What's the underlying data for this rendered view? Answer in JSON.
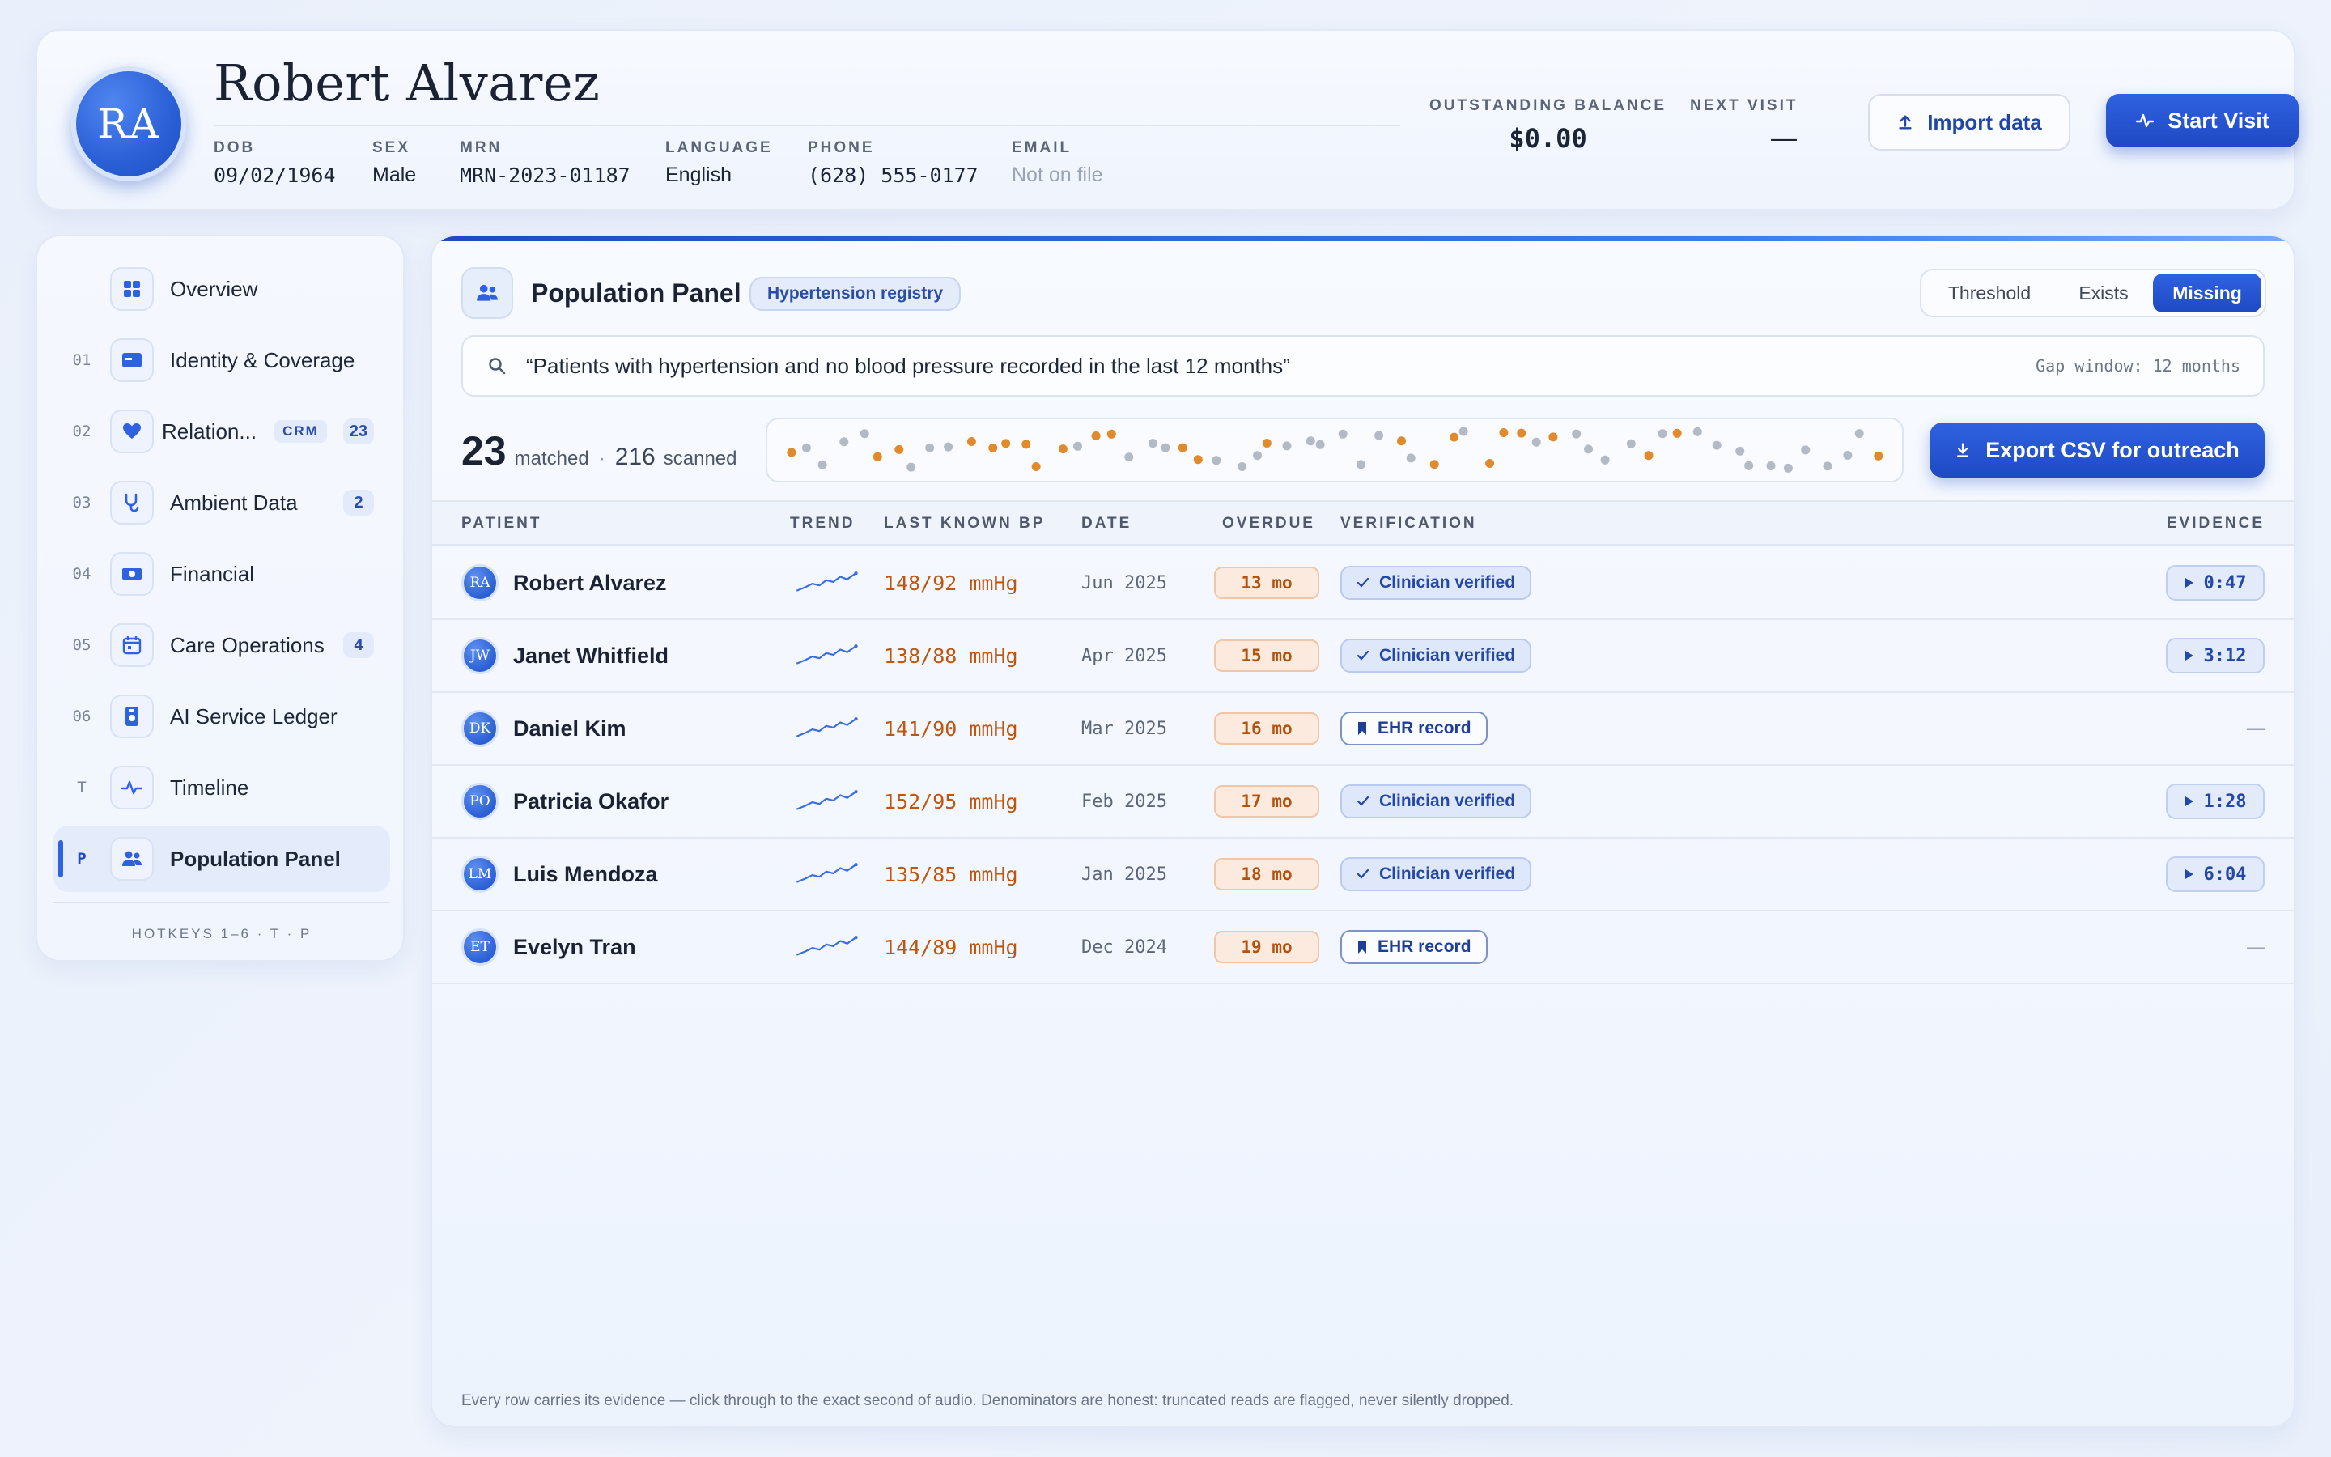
{
  "header": {
    "initials": "RA",
    "name": "Robert Alvarez",
    "fields": [
      {
        "label": "DOB",
        "value": "09/02/1964"
      },
      {
        "label": "SEX",
        "value": "Male"
      },
      {
        "label": "MRN",
        "value": "MRN-2023-01187"
      },
      {
        "label": "LANGUAGE",
        "value": "English"
      },
      {
        "label": "PHONE",
        "value": "(628) 555-0177"
      },
      {
        "label": "EMAIL",
        "value": "Not on file"
      }
    ],
    "balance_label": "OUTSTANDING BALANCE",
    "balance_value": "$0.00",
    "next_visit_label": "NEXT VISIT",
    "next_visit_value": "—",
    "import_label": "Import data",
    "start_label": "Start Visit"
  },
  "sidebar": {
    "items": [
      {
        "num": "",
        "label": "Overview",
        "icon": "grid-icon"
      },
      {
        "num": "01",
        "label": "Identity & Coverage",
        "icon": "id-card-icon"
      },
      {
        "num": "02",
        "label": "Relation...",
        "icon": "heart-icon",
        "badge": "CRM",
        "count": "23"
      },
      {
        "num": "03",
        "label": "Ambient Data",
        "icon": "stethoscope-icon",
        "count": "2"
      },
      {
        "num": "04",
        "label": "Financial",
        "icon": "cash-icon"
      },
      {
        "num": "05",
        "label": "Care Operations",
        "icon": "calendar-icon",
        "count": "4"
      },
      {
        "num": "06",
        "label": "AI Service Ledger",
        "icon": "ledger-icon"
      },
      {
        "num": "T",
        "label": "Timeline",
        "icon": "pulse-icon"
      },
      {
        "num": "P",
        "label": "Population Panel",
        "icon": "people-icon",
        "active": true
      }
    ],
    "hotkeys": "HOTKEYS 1–6 · T · P"
  },
  "panel": {
    "title": "Population Panel",
    "registry": "Hypertension registry",
    "modes": [
      "Threshold",
      "Exists",
      "Missing"
    ],
    "active_mode": "Missing",
    "query": "“Patients with hypertension and no blood pressure recorded in the last 12 months”",
    "gap_window": "Gap window: 12 months",
    "matched_count": "23",
    "matched_label": "matched",
    "separator": "·",
    "scanned_count": "216",
    "scanned_label": "scanned",
    "export_label": "Export CSV for outreach",
    "footnote": "Every row carries its evidence — click through to the exact second of audio. Denominators are honest: truncated reads are flagged, never silently dropped."
  },
  "table": {
    "headers": [
      "PATIENT",
      "TREND",
      "LAST KNOWN BP",
      "DATE",
      "OVERDUE",
      "VERIFICATION",
      "EVIDENCE"
    ],
    "rows": [
      {
        "initials": "RA",
        "name": "Robert Alvarez",
        "bp": "148/92 mmHg",
        "date": "Jun 2025",
        "overdue": "13 mo",
        "verification": "Clinician verified",
        "vtype": "clinician",
        "evidence": "0:47"
      },
      {
        "initials": "JW",
        "name": "Janet Whitfield",
        "bp": "138/88 mmHg",
        "date": "Apr 2025",
        "overdue": "15 mo",
        "verification": "Clinician verified",
        "vtype": "clinician",
        "evidence": "3:12"
      },
      {
        "initials": "DK",
        "name": "Daniel Kim",
        "bp": "141/90 mmHg",
        "date": "Mar 2025",
        "overdue": "16 mo",
        "verification": "EHR record",
        "vtype": "ehr",
        "evidence": "—"
      },
      {
        "initials": "PO",
        "name": "Patricia Okafor",
        "bp": "152/95 mmHg",
        "date": "Feb 2025",
        "overdue": "17 mo",
        "verification": "Clinician verified",
        "vtype": "clinician",
        "evidence": "1:28"
      },
      {
        "initials": "LM",
        "name": "Luis Mendoza",
        "bp": "135/85 mmHg",
        "date": "Jan 2025",
        "overdue": "18 mo",
        "verification": "Clinician verified",
        "vtype": "clinician",
        "evidence": "6:04"
      },
      {
        "initials": "ET",
        "name": "Evelyn Tran",
        "bp": "144/89 mmHg",
        "date": "Dec 2024",
        "overdue": "19 mo",
        "verification": "EHR record",
        "vtype": "ehr",
        "evidence": "—"
      }
    ]
  },
  "colors": {
    "accent": "#1f49c4",
    "overdue": "#c0560e",
    "dot_orange": "#e08a2c",
    "dot_grey": "#b4bac5"
  }
}
